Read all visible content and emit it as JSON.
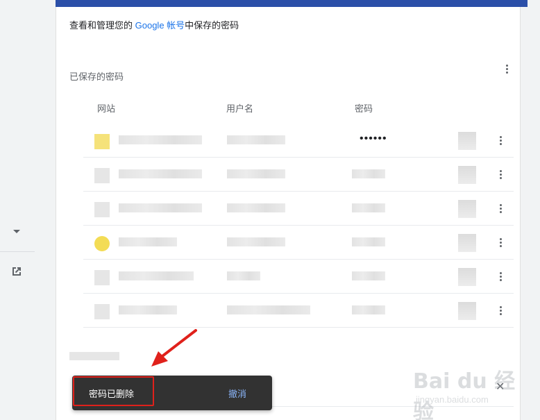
{
  "intro": {
    "prefix": "查看和管理您的 ",
    "link": "Google 帐号",
    "suffix": "中保存的密码"
  },
  "section": {
    "title": "已保存的密码"
  },
  "columns": {
    "site": "网站",
    "username": "用户名",
    "password": "密码"
  },
  "rows": [
    {
      "password": "••••••"
    }
  ],
  "snackbar": {
    "message": "密码已删除",
    "undo": "撤消"
  },
  "watermark": {
    "main": "Bai du 经验",
    "sub": "jingyan.baidu.com"
  },
  "colors": {
    "accent": "#1a73e8",
    "snackbar_bg": "#323232",
    "undo": "#8ab4f8",
    "highlight": "#e0211b",
    "topbar": "#2b4fa8"
  },
  "icons": [
    "chevron-down-icon",
    "open-in-new-icon",
    "more-vert-icon",
    "close-icon",
    "arrow-annotation-icon"
  ]
}
